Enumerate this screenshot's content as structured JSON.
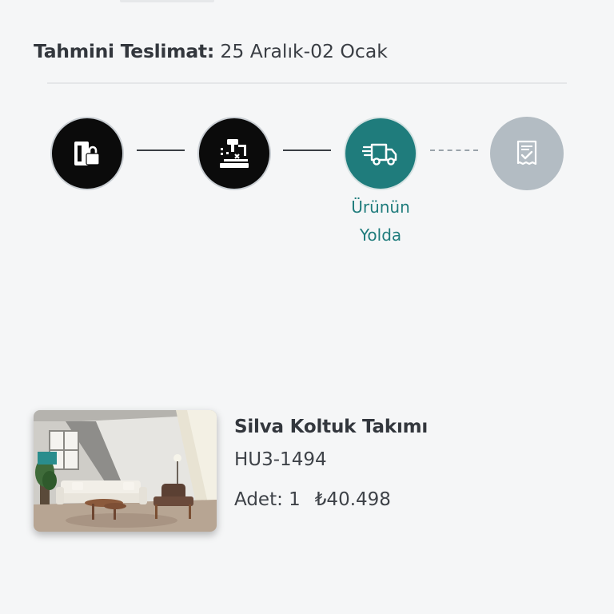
{
  "delivery": {
    "label": "Tahmini Teslimat:",
    "value": "25 Aralık-02 Ocak"
  },
  "tracker": {
    "steps": [
      {
        "icon": "order-lock-icon",
        "state": "done"
      },
      {
        "icon": "production-tools-icon",
        "state": "done"
      },
      {
        "icon": "delivery-truck-icon",
        "state": "active",
        "label_line1": "Ürünün",
        "label_line2": "Yolda"
      },
      {
        "icon": "checklist-document-icon",
        "state": "pending"
      }
    ],
    "colors": {
      "done": "#0b0b0b",
      "active": "#1f7c7c",
      "pending": "#b3bcc3"
    }
  },
  "product": {
    "name": "Silva Koltuk Takımı",
    "code": "HU3-1494",
    "qty_label": "Adet: 1",
    "price": "₺40.498"
  }
}
